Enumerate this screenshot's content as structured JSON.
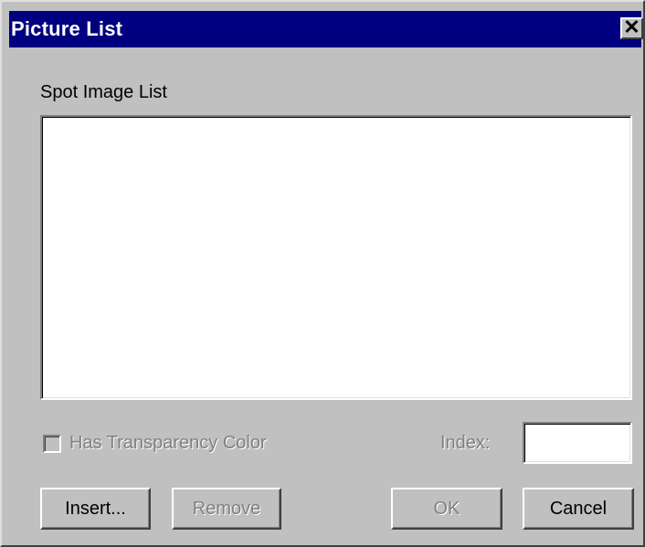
{
  "window": {
    "title": "Picture List",
    "close_glyph": "✕"
  },
  "list": {
    "label": "Spot Image List",
    "items": []
  },
  "options": {
    "transparency_checkbox_label": "Has Transparency Color",
    "transparency_checked": false,
    "transparency_enabled": false,
    "index_label": "Index:",
    "index_value": ""
  },
  "buttons": {
    "insert_label": "Insert...",
    "remove_label": "Remove",
    "ok_label": "OK",
    "cancel_label": "Cancel"
  },
  "colors": {
    "titlebar": "#000080",
    "face": "#c0c0c0",
    "disabled_text": "#808080"
  }
}
